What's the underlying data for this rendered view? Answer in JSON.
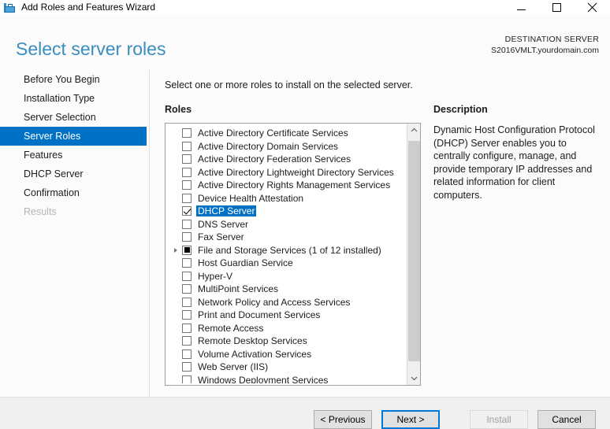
{
  "window": {
    "title": "Add Roles and Features Wizard",
    "app_icon": "toolbox-icon",
    "controls": {
      "minimize": "minimize-icon",
      "maximize": "maximize-icon",
      "close": "close-icon"
    }
  },
  "header": {
    "page_title": "Select server roles",
    "destination_label": "DESTINATION SERVER",
    "destination_server": "S2016VMLT.yourdomain.com",
    "title_color": "#3a8dc0"
  },
  "sidebar": {
    "items": [
      {
        "label": "Before You Begin",
        "state": "normal"
      },
      {
        "label": "Installation Type",
        "state": "normal"
      },
      {
        "label": "Server Selection",
        "state": "normal"
      },
      {
        "label": "Server Roles",
        "state": "selected"
      },
      {
        "label": "Features",
        "state": "normal"
      },
      {
        "label": "DHCP Server",
        "state": "normal"
      },
      {
        "label": "Confirmation",
        "state": "normal"
      },
      {
        "label": "Results",
        "state": "disabled"
      }
    ],
    "selected_color": "#0072c6"
  },
  "main": {
    "instruction": "Select one or more roles to install on the selected server.",
    "roles_label": "Roles",
    "description_label": "Description",
    "description_text": "Dynamic Host Configuration Protocol (DHCP) Server enables you to centrally configure, manage, and provide temporary IP addresses and related information for client computers.",
    "selection_color": "#0072c6",
    "roles": [
      {
        "label": "Active Directory Certificate Services",
        "checked": "unchecked",
        "selected": false,
        "expandable": false
      },
      {
        "label": "Active Directory Domain Services",
        "checked": "unchecked",
        "selected": false,
        "expandable": false
      },
      {
        "label": "Active Directory Federation Services",
        "checked": "unchecked",
        "selected": false,
        "expandable": false
      },
      {
        "label": "Active Directory Lightweight Directory Services",
        "checked": "unchecked",
        "selected": false,
        "expandable": false
      },
      {
        "label": "Active Directory Rights Management Services",
        "checked": "unchecked",
        "selected": false,
        "expandable": false
      },
      {
        "label": "Device Health Attestation",
        "checked": "unchecked",
        "selected": false,
        "expandable": false
      },
      {
        "label": "DHCP Server",
        "checked": "checked",
        "selected": true,
        "expandable": false
      },
      {
        "label": "DNS Server",
        "checked": "unchecked",
        "selected": false,
        "expandable": false
      },
      {
        "label": "Fax Server",
        "checked": "unchecked",
        "selected": false,
        "expandable": false
      },
      {
        "label": "File and Storage Services (1 of 12 installed)",
        "checked": "partial",
        "selected": false,
        "expandable": true
      },
      {
        "label": "Host Guardian Service",
        "checked": "unchecked",
        "selected": false,
        "expandable": false
      },
      {
        "label": "Hyper-V",
        "checked": "unchecked",
        "selected": false,
        "expandable": false
      },
      {
        "label": "MultiPoint Services",
        "checked": "unchecked",
        "selected": false,
        "expandable": false
      },
      {
        "label": "Network Policy and Access Services",
        "checked": "unchecked",
        "selected": false,
        "expandable": false
      },
      {
        "label": "Print and Document Services",
        "checked": "unchecked",
        "selected": false,
        "expandable": false
      },
      {
        "label": "Remote Access",
        "checked": "unchecked",
        "selected": false,
        "expandable": false
      },
      {
        "label": "Remote Desktop Services",
        "checked": "unchecked",
        "selected": false,
        "expandable": false
      },
      {
        "label": "Volume Activation Services",
        "checked": "unchecked",
        "selected": false,
        "expandable": false
      },
      {
        "label": "Web Server (IIS)",
        "checked": "unchecked",
        "selected": false,
        "expandable": false
      },
      {
        "label": "Windows Deployment Services",
        "checked": "unchecked",
        "selected": false,
        "expandable": false
      }
    ],
    "scrollbar": {
      "up_icon": "chevron-up-icon",
      "down_icon": "chevron-down-icon"
    }
  },
  "footer": {
    "previous_label": "< Previous",
    "next_label": "Next >",
    "install_label": "Install",
    "cancel_label": "Cancel",
    "focus_color": "#0078d7"
  }
}
